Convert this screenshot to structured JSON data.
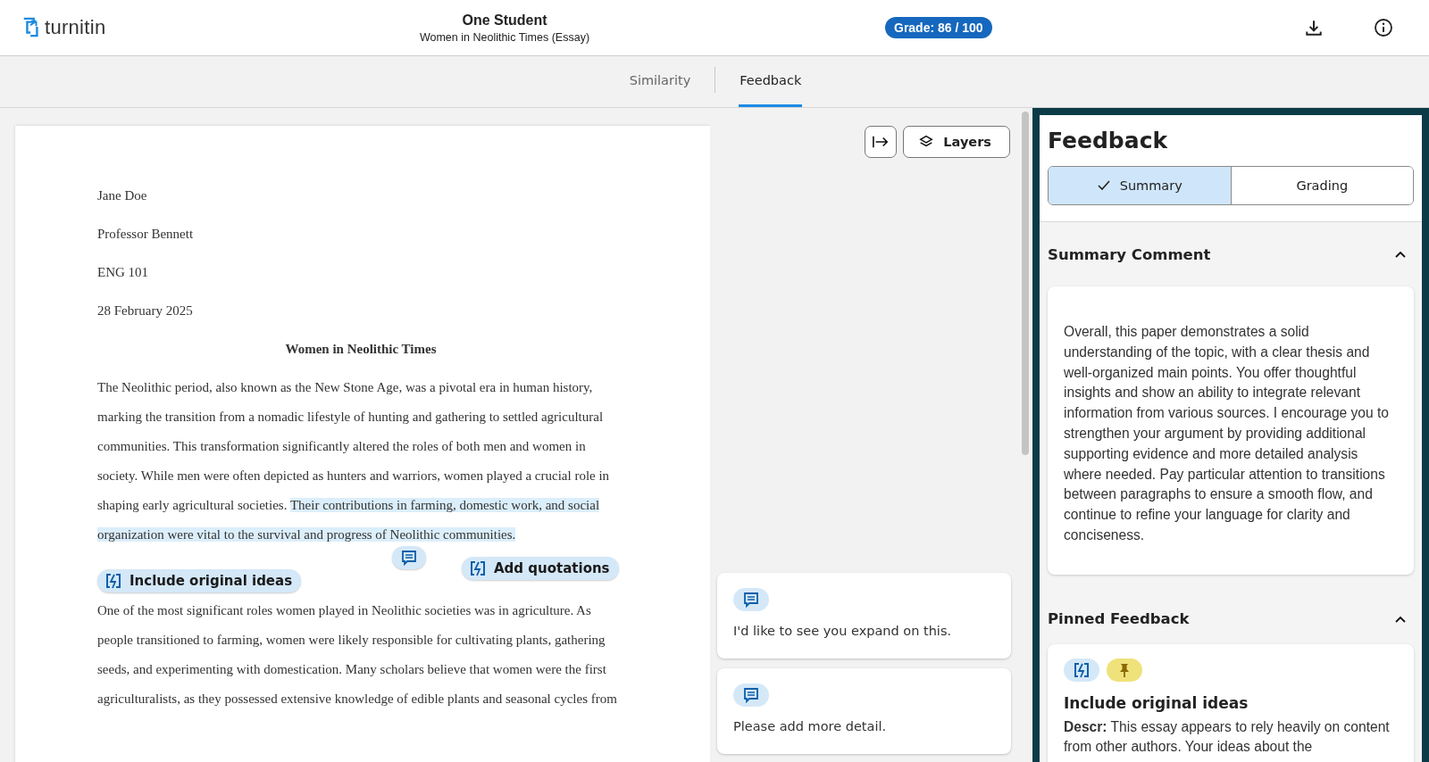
{
  "header": {
    "logo": "turnitin",
    "title": "One Student",
    "subtitle": "Women in Neolithic Times (Essay)",
    "grade": "Grade: 86 / 100"
  },
  "tabs": [
    {
      "label": "Similarity",
      "selected": false
    },
    {
      "label": "Feedback",
      "selected": true
    }
  ],
  "document": {
    "header_lines": [
      "Jane Doe",
      "Professor Bennett",
      "ENG 101",
      "28 February 2025"
    ],
    "title": "Women in Neolithic Times",
    "paragraphs": [
      [
        {
          "text": "The Neolithic period, also known as the New Stone Age, was a pivotal era in human history, marking the transition from a nomadic lifestyle of hunting and gathering to settled agricultural communities. This transformation significantly altered the roles of both men and women in society. While men were often depicted as hunters and warriors, women played a crucial role in shaping early agricultural societies. ",
          "highlighted": false
        },
        {
          "text": "Their contributions in farming, domestic work, and social organization were vital to the survival and progress of Neolithic communities.",
          "highlighted": true
        }
      ],
      [
        {
          "text": "One of the most significant roles women played in Neolithic societies was in agriculture. As people transitioned to farming, women were likely responsible for cultivating plants, gathering seeds, and experimenting with domestication. Many scholars believe that women were the first agriculturalists, as they possessed extensive knowledge of edible plants and seasonal cycles from",
          "highlighted": false
        }
      ]
    ],
    "markers": [
      {
        "kind": "comment"
      },
      {
        "kind": "feedback",
        "label": "Add quotations"
      },
      {
        "kind": "feedback",
        "label": "Include original ideas"
      }
    ]
  },
  "toolbar": {
    "layers_button": "Layers"
  },
  "comments": [
    {
      "text": "I'd like to see you expand on this."
    },
    {
      "text": "Please add more detail."
    }
  ],
  "panel": {
    "title": "Feedback",
    "views": [
      {
        "label": "Summary",
        "selected": true
      },
      {
        "label": "Grading",
        "selected": false
      }
    ],
    "summary": {
      "title": "Summary Comment",
      "expanded": true,
      "text": "Overall, this paper demonstrates a solid understanding of the topic, with a clear thesis and well-organized main points. You offer thoughtful insights and show an ability to integrate relevant information from various sources. I encourage you to strengthen your argument by providing additional supporting evidence and more detailed analysis where needed. Pay particular attention to transitions between paragraphs to ensure a smooth flow, and continue to refine your language for clarity and conciseness."
    },
    "pinned": {
      "title": "Pinned Feedback",
      "expanded": true,
      "items": [
        {
          "title": "Include original ideas",
          "pinned": true,
          "description": "**Descr:** This essay appears to rely heavily on content from other authors. Your ideas about the"
        }
      ]
    }
  }
}
